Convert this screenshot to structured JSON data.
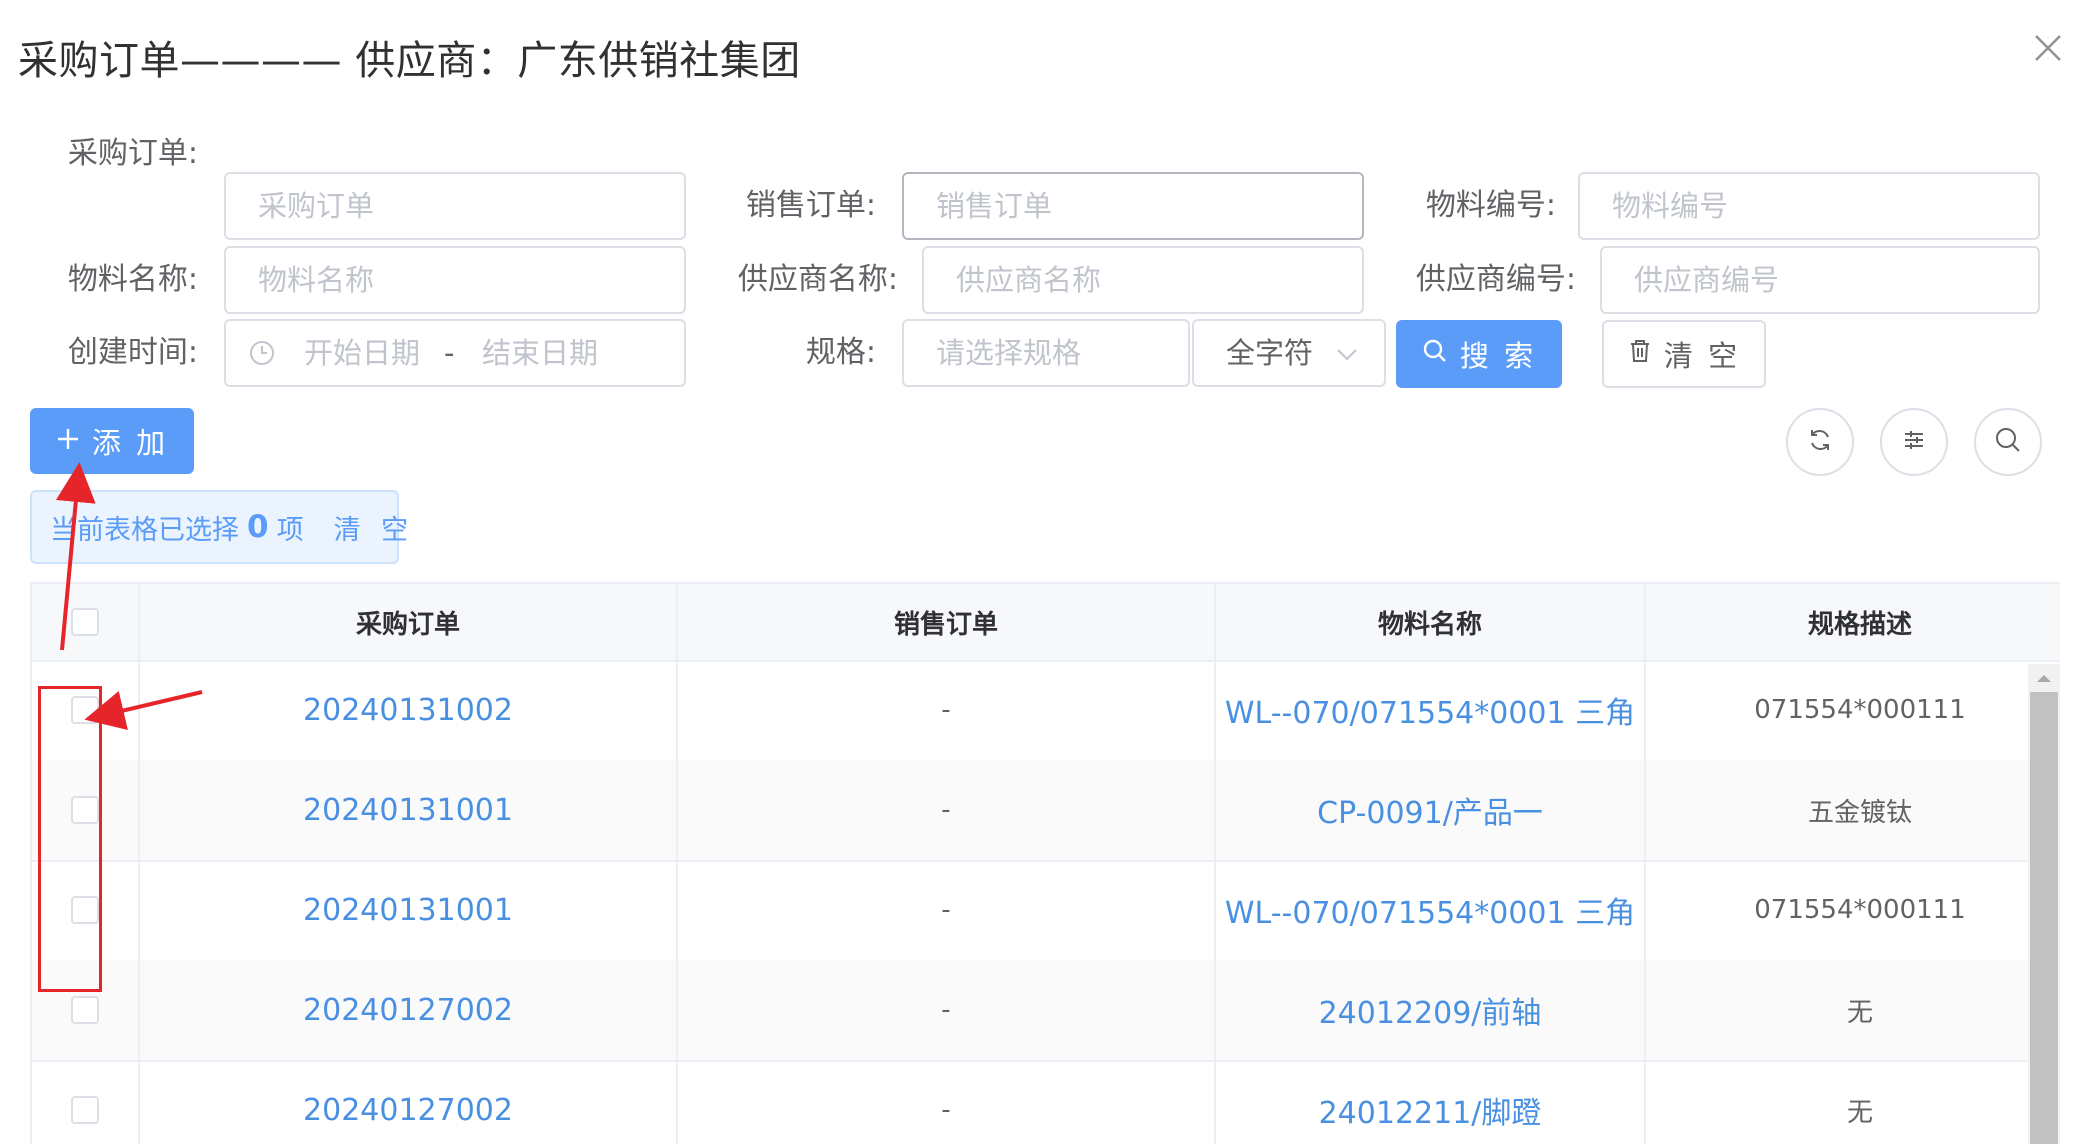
{
  "dialog": {
    "title": "采购订单———— 供应商：广东供销社集团"
  },
  "filters": {
    "purchase_order": {
      "label": "采购订单:",
      "placeholder": "采购订单"
    },
    "sales_order": {
      "label": "销售订单:",
      "placeholder": "销售订单"
    },
    "material_code": {
      "label": "物料编号:",
      "placeholder": "物料编号"
    },
    "material_name": {
      "label": "物料名称:",
      "placeholder": "物料名称"
    },
    "supplier_name": {
      "label": "供应商名称:",
      "placeholder": "供应商名称"
    },
    "supplier_code": {
      "label": "供应商编号:",
      "placeholder": "供应商编号"
    },
    "created_time": {
      "label": "创建时间:",
      "start_placeholder": "开始日期",
      "separator": "-",
      "end_placeholder": "结束日期"
    },
    "spec": {
      "label": "规格:",
      "placeholder": "请选择规格",
      "match_mode": "全字符"
    }
  },
  "actions": {
    "search": "搜 索",
    "clear": "清 空",
    "add": "添 加"
  },
  "selection": {
    "prefix": "当前表格已选择",
    "count": "0",
    "suffix": "项",
    "clear": "清 空"
  },
  "table": {
    "columns": [
      "采购订单",
      "销售订单",
      "物料名称",
      "规格描述"
    ],
    "rows": [
      {
        "purchase_order": "20240131002",
        "sales_order": "-",
        "material_name": "WL--070/071554*0001 三角",
        "spec": "071554*000111"
      },
      {
        "purchase_order": "20240131001",
        "sales_order": "-",
        "material_name": "CP-0091/产品一",
        "spec": "五金镀钛"
      },
      {
        "purchase_order": "20240131001",
        "sales_order": "-",
        "material_name": "WL--070/071554*0001 三角",
        "spec": "071554*000111"
      },
      {
        "purchase_order": "20240127002",
        "sales_order": "-",
        "material_name": "24012209/前轴",
        "spec": "无"
      },
      {
        "purchase_order": "20240127002",
        "sales_order": "-",
        "material_name": "24012211/脚蹬",
        "spec": "无"
      }
    ]
  },
  "colors": {
    "primary": "#5b9cf8",
    "link": "#4a90e2",
    "annotation": "#e5252a"
  }
}
